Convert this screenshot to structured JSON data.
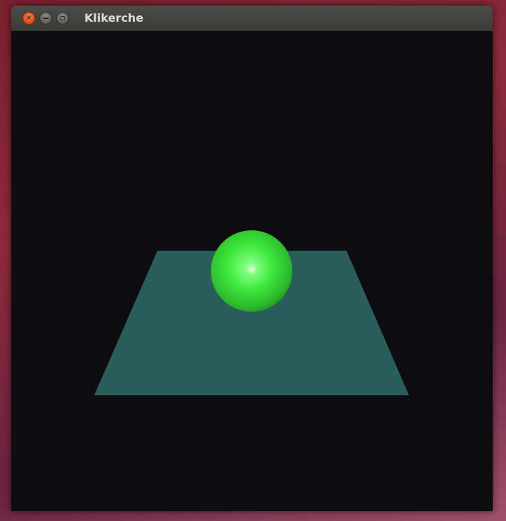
{
  "window": {
    "title": "Klikerche",
    "close_icon": "close-icon",
    "minimize_icon": "minimize-icon",
    "maximize_icon": "maximize-icon"
  },
  "scene": {
    "background_color": "#0d0c0f",
    "plane_color": "#2a5e5c",
    "sphere_color": "#33e033"
  }
}
